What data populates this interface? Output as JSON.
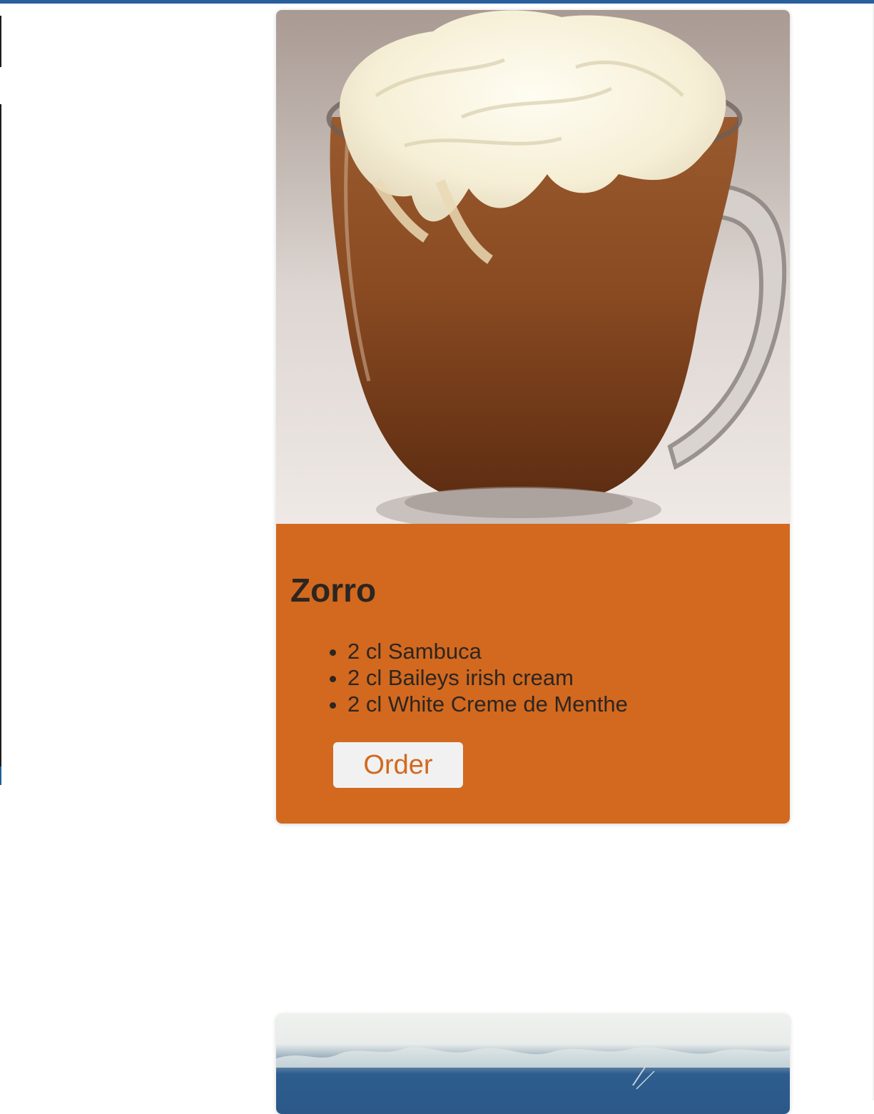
{
  "drinks": [
    {
      "name": "Zorro",
      "image_icon": "coffee-mug-whipped-cream-photo",
      "ingredients": [
        "2 cl Sambuca",
        "2 cl Baileys irish cream",
        "2 cl White Creme de Menthe"
      ],
      "order_label": "Order"
    },
    {
      "image_icon": "blue-cocktail-photo"
    }
  ],
  "colors": {
    "card_accent": "#d2691f",
    "top_bar": "#2a5f9e",
    "text_dark": "#2d2520",
    "button_bg": "#f1f1f1"
  }
}
